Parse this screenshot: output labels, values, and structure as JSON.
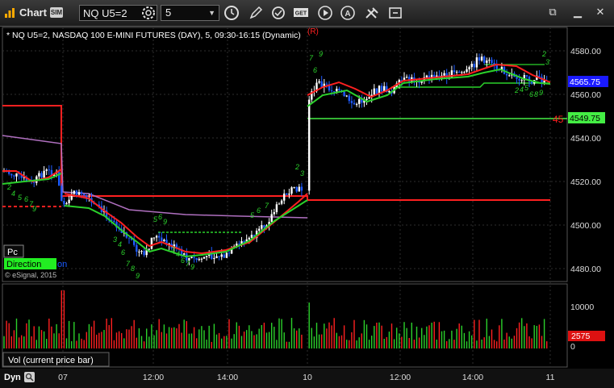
{
  "toolbar": {
    "title": "Chart",
    "sim_badge": "SIM",
    "symbol": "NQ U5=2",
    "interval": "5",
    "icons": [
      "settings-gear-icon",
      "clock-icon",
      "pencil-icon",
      "refresh-icon",
      "get-quote-icon",
      "play-icon",
      "alert-icon",
      "tools-icon",
      "link-icon"
    ],
    "window_buttons": [
      "link-window-icon",
      "minimize-icon",
      "close-icon"
    ]
  },
  "chart": {
    "header": "* NQ U5=2, NASDAQ 100 E-MINI FUTURES (DAY), 5, 09:30-16:15 (Dynamic)",
    "r_marker": "(R)",
    "price_axis": [
      "4580.00",
      "4560.00",
      "4540.00",
      "4520.00",
      "4500.00",
      "4480.00"
    ],
    "last_price_badge": "4565.75",
    "level_badge": "4549.75",
    "level_side_label": "45",
    "pc_label": "Pc",
    "direction_label": "Direction",
    "direction_tail": "on",
    "copyright": "© eSignal, 2015"
  },
  "volume_pane": {
    "title": "Vol (current price bar)",
    "axis": [
      "10000",
      "0"
    ],
    "last_badge": "2575"
  },
  "time_axis": {
    "mode_label": "Dyn",
    "labels": [
      "07",
      "12:00",
      "14:00",
      "10",
      "12:00",
      "14:00",
      "11"
    ]
  },
  "colors": {
    "background": "#000000",
    "up": "#ffffff",
    "down": "#1e5bff",
    "green": "#2bd12b",
    "red": "#ff2020",
    "purple": "#b070c0",
    "grid": "#333333",
    "level": "#44ee44"
  }
}
